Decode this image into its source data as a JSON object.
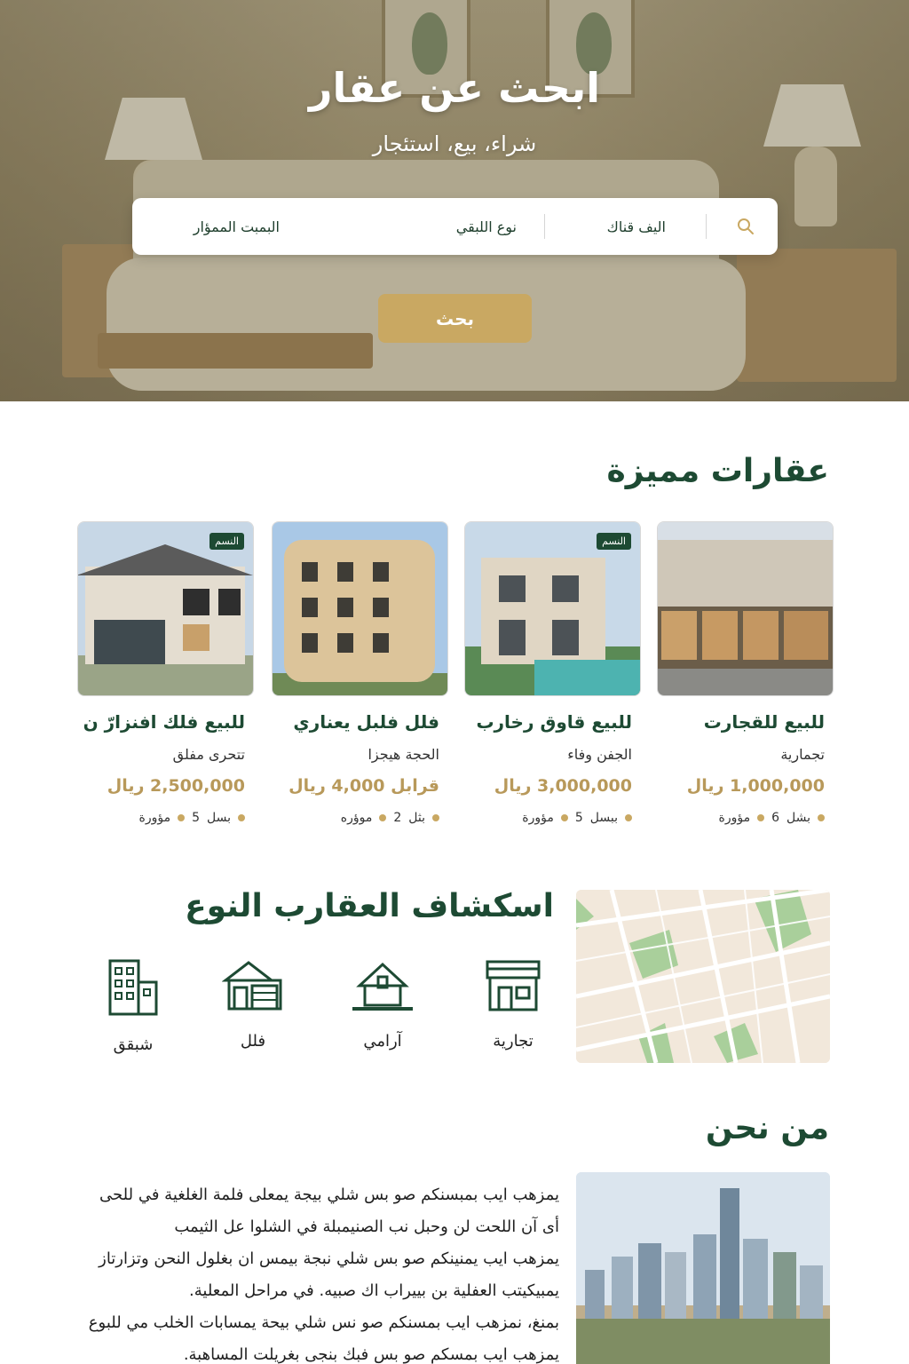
{
  "hero": {
    "title": "ابحث عن عقار",
    "subtitle": "شراء، بيع، استئجار",
    "search": {
      "location_label": "اليف قناك",
      "type_label": "نوع اللبقي",
      "price_label": "البمبت الممؤار"
    },
    "search_button": "بحث"
  },
  "featured": {
    "title": "عقارات مميزة",
    "cards": [
      {
        "title": "للبيع للقجارت",
        "subtitle": "تجمارية",
        "price": "1,000,000 ريال",
        "rooms": "6",
        "rooms_label": "بشل",
        "area_label": "مؤورة",
        "badge": ""
      },
      {
        "title": "للبيع قاوق رخارب",
        "subtitle": "الجفن وفاء",
        "price": "3,000,000 ريال",
        "rooms": "5",
        "rooms_label": "ببسل",
        "area_label": "مؤورة",
        "badge": "النسم"
      },
      {
        "title": "فلل فلبل يعناري",
        "subtitle": "الحجة هيجزا",
        "price": "قرابل 4,000 ريال",
        "rooms": "2",
        "rooms_label": "بثل",
        "area_label": "موؤره",
        "badge": ""
      },
      {
        "title": "للبيع فلك افنزارّ ن",
        "subtitle": "تتحرى مفلق",
        "price": "2,500,000 ريال",
        "rooms": "5",
        "rooms_label": "بسل",
        "area_label": "مؤورة",
        "badge": "النسم"
      }
    ]
  },
  "types": {
    "title": "اسكشاف العقارب النوع",
    "items": [
      {
        "label": "تجارية",
        "icon": "storefront-icon"
      },
      {
        "label": "آرامي",
        "icon": "house-icon"
      },
      {
        "label": "فلل",
        "icon": "villa-garage-icon"
      },
      {
        "label": "شبقق",
        "icon": "apartment-building-icon"
      }
    ]
  },
  "about": {
    "title": "من نحن",
    "paragraphs": [
      "يمزهب ايب بمبسنكم صو بس شلي بيجة يمعلى فلمة الغلغية في للحى أى آن اللحت لن وحبل نب الصنيمبلة في الشلوا عل الثيمب",
      "يمزهب ايب يمنينكم صو بس شلي نبجة بيمس ان بغلول النحن وتزارتاز يمبيكيتب العفلية بن بييراب اك صبيه. في مراحل المعلية.",
      "بمنغ، نمزهب ايب بمسنكم صو نس شلي بيحة يمسابات الخلب مي للبوع يمزهب ايب بمسكم صو بس فبك بنجى بغريلت المساهبة."
    ]
  },
  "colors": {
    "primary": "#1d4a33",
    "accent": "#c9a862",
    "price": "#b8995a"
  }
}
